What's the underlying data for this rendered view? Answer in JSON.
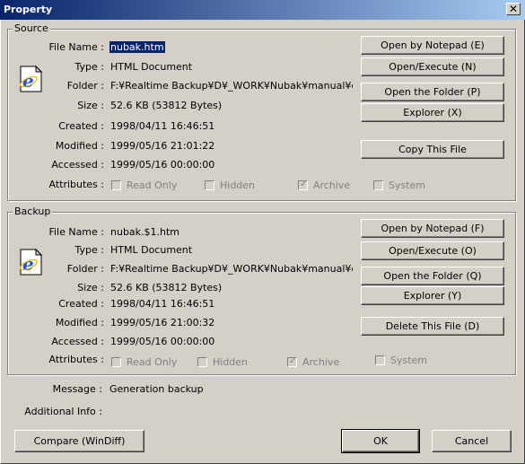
{
  "window": {
    "title": "Property",
    "close_glyph": "✕"
  },
  "source": {
    "group_label": "Source",
    "labels": {
      "file_name": "File Name :",
      "type": "Type :",
      "folder": "Folder :",
      "size": "Size :",
      "created": "Created :",
      "modified": "Modified :",
      "accessed": "Accessed :",
      "attributes": "Attributes :"
    },
    "values": {
      "file_name": "nubak.htm",
      "type": "HTML Document",
      "folder": "F:¥Realtime Backup¥D¥_WORK¥Nubak¥manual¥engli",
      "size": "52.6 KB  (53812 Bytes)",
      "created": "1998/04/11 16:46:51",
      "modified": "1999/05/16 21:01:22",
      "accessed": "1999/05/16 00:00:00"
    },
    "attributes": [
      {
        "label": "Read Only",
        "checked": false
      },
      {
        "label": "Hidden",
        "checked": false
      },
      {
        "label": "Archive",
        "checked": true
      },
      {
        "label": "System",
        "checked": false
      }
    ],
    "buttons": {
      "open_notepad": "Open by Notepad (E)",
      "open_execute": "Open/Execute (N)",
      "open_folder": "Open the Folder (P)",
      "explorer": "Explorer (X)",
      "copy_file": "Copy This File"
    },
    "icon": "ie-html-document-icon"
  },
  "backup": {
    "group_label": "Backup",
    "labels": {
      "file_name": "File Name :",
      "type": "Type :",
      "folder": "Folder :",
      "size": "Size :",
      "created": "Created :",
      "modified": "Modified :",
      "accessed": "Accessed :",
      "attributes": "Attributes :"
    },
    "values": {
      "file_name": "nubak.$1.htm",
      "type": "HTML Document",
      "folder": "F:¥Realtime Backup¥D¥_WORK¥Nubak¥manual¥engli",
      "size": "52.6 KB  (53812 Bytes)",
      "created": "1998/04/11 16:46:51",
      "modified": "1999/05/16 21:00:32",
      "accessed": "1999/05/16 00:00:00"
    },
    "attributes": [
      {
        "label": "Read Only",
        "checked": false
      },
      {
        "label": "Hidden",
        "checked": false
      },
      {
        "label": "Archive",
        "checked": true
      },
      {
        "label": "System",
        "checked": false
      }
    ],
    "buttons": {
      "open_notepad": "Open by Notepad (F)",
      "open_execute": "Open/Execute (O)",
      "open_folder": "Open the Folder (Q)",
      "explorer": "Explorer (Y)",
      "delete_file": "Delete This File (D)"
    },
    "icon": "ie-html-document-icon"
  },
  "footer": {
    "message_label": "Message :",
    "message_value": "Generation backup",
    "additional_label": "Additional Info :",
    "additional_value": "",
    "compare_button": "Compare (WinDiff)",
    "ok_button": "OK",
    "cancel_button": "Cancel"
  },
  "colors": {
    "titlebar_start": "#0a246a",
    "titlebar_end": "#a6caf0",
    "face": "#d4d0c8",
    "selection": "#0a246a",
    "ie_icon_blue": "#1e5bd8"
  }
}
